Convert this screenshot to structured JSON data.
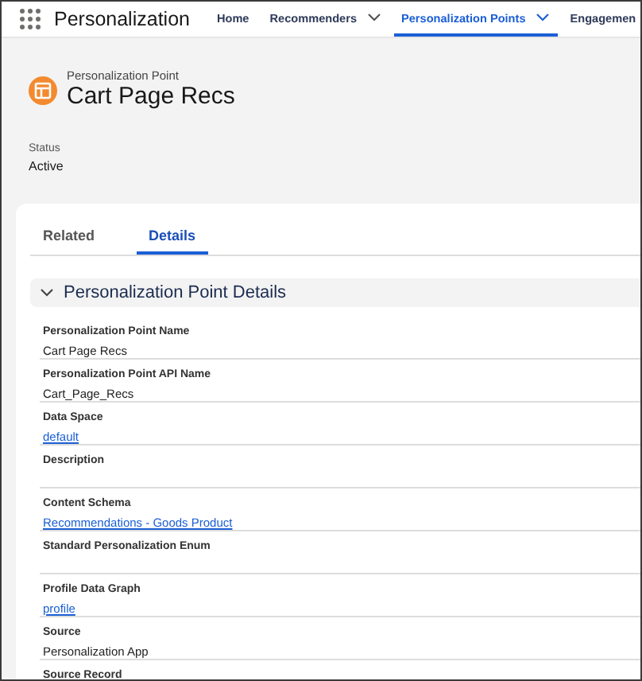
{
  "app": {
    "title": "Personalization"
  },
  "nav": [
    {
      "label": "Home",
      "has_menu": false,
      "selected": false
    },
    {
      "label": "Recommenders",
      "has_menu": true,
      "selected": false
    },
    {
      "label": "Personalization Points",
      "has_menu": true,
      "selected": true
    },
    {
      "label": "Engagemen",
      "has_menu": false,
      "selected": false
    }
  ],
  "record": {
    "type": "Personalization Point",
    "name": "Cart Page Recs"
  },
  "highlights": [
    {
      "label": "Status",
      "value": "Active"
    }
  ],
  "tabs": [
    {
      "label": "Related",
      "selected": false
    },
    {
      "label": "Details",
      "selected": true
    }
  ],
  "section": {
    "title": "Personalization Point Details",
    "expanded": true,
    "fields": [
      {
        "label": "Personalization Point Name",
        "kind": "text",
        "value": "Cart Page Recs"
      },
      {
        "label": "Personalization Point API Name",
        "kind": "text",
        "value": "Cart_Page_Recs"
      },
      {
        "label": "Data Space",
        "kind": "link",
        "value": "default"
      },
      {
        "label": "Description",
        "kind": "empty"
      },
      {
        "label": "Content Schema",
        "kind": "link",
        "value": "Recommendations - Goods Product"
      },
      {
        "label": "Standard Personalization Enum",
        "kind": "empty"
      },
      {
        "label": "Profile Data Graph",
        "kind": "link",
        "value": "profile"
      },
      {
        "label": "Source",
        "kind": "text",
        "value": "Personalization App"
      },
      {
        "label": "Source Record",
        "kind": "empty"
      }
    ]
  }
}
